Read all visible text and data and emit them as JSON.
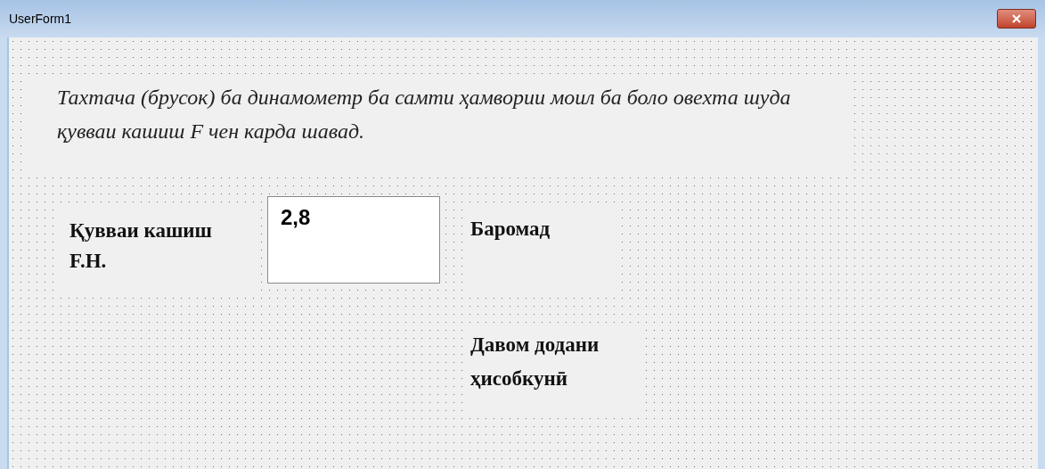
{
  "window": {
    "title": "UserForm1"
  },
  "caption": "Тахтача (брусок) ба динамометр ба самти ҳамвории моил ба боло овехта шуда қувваи кашиш F чен карда шавад.",
  "force_label": "Қувваи кашиш F.H.",
  "force_field": {
    "value": "2,8"
  },
  "output_label": "Баромад",
  "continue_label": "Давом додани ҳисобкунӣ"
}
